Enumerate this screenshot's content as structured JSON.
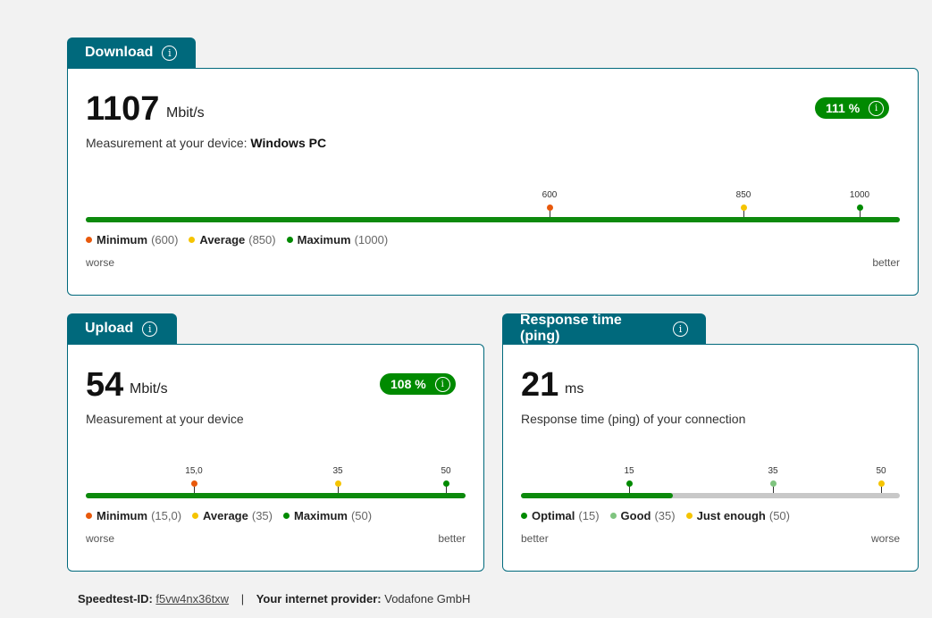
{
  "colors": {
    "teal": "#00697c",
    "green": "#008a00",
    "orange": "#e8590c",
    "yellow": "#f5c400",
    "lightgreen": "#7fc47f"
  },
  "download": {
    "tab_label": "Download",
    "value": "1107",
    "unit": "Mbit/s",
    "sub_prefix": "Measurement at your device: ",
    "sub_device": "Windows PC",
    "badge": "111 %",
    "fill_fraction": 1.0,
    "ticks": [
      "600",
      "850",
      "1000"
    ],
    "legend": [
      {
        "label": "Minimum",
        "value": "(600)"
      },
      {
        "label": "Average",
        "value": "(850)"
      },
      {
        "label": "Maximum",
        "value": "(1000)"
      }
    ],
    "left_label": "worse",
    "right_label": "better"
  },
  "upload": {
    "tab_label": "Upload",
    "value": "54",
    "unit": "Mbit/s",
    "sub": "Measurement at your device",
    "badge": "108 %",
    "fill_fraction": 1.0,
    "ticks": [
      "15,0",
      "35",
      "50"
    ],
    "legend": [
      {
        "label": "Minimum",
        "value": "(15,0)"
      },
      {
        "label": "Average",
        "value": "(35)"
      },
      {
        "label": "Maximum",
        "value": "(50)"
      }
    ],
    "left_label": "worse",
    "right_label": "better"
  },
  "ping": {
    "tab_label": "Response time (ping)",
    "value": "21",
    "unit": "ms",
    "sub": "Response time (ping) of your connection",
    "fill_fraction": 0.4,
    "ticks": [
      "15",
      "35",
      "50"
    ],
    "legend": [
      {
        "label": "Optimal",
        "value": "(15)"
      },
      {
        "label": "Good",
        "value": "(35)"
      },
      {
        "label": "Just enough",
        "value": "(50)"
      }
    ],
    "left_label": "better",
    "right_label": "worse"
  },
  "footer": {
    "id_label": "Speedtest-ID:",
    "id_value": "f5vw4nx36txw",
    "sep": "|",
    "provider_label": "Your internet provider:",
    "provider_value": "Vodafone GmbH"
  }
}
